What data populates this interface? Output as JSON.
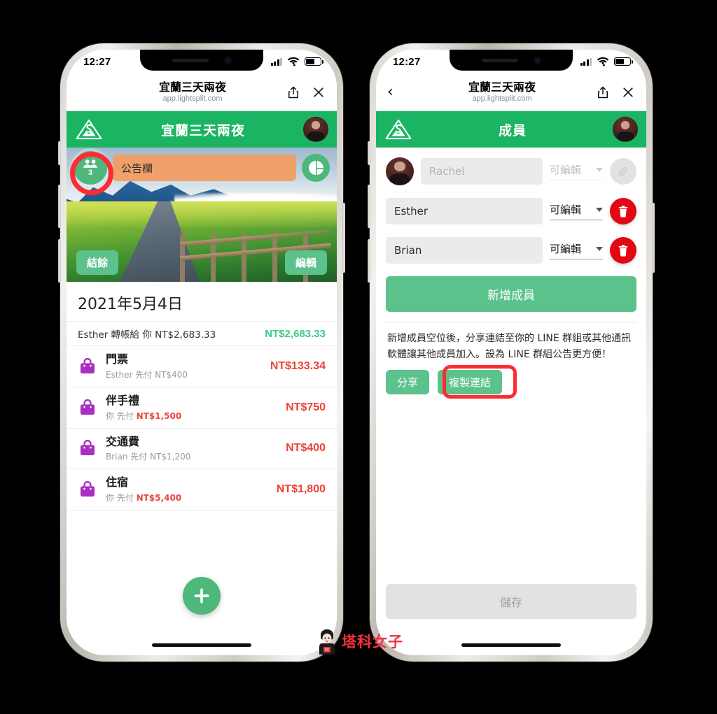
{
  "statusbar": {
    "time": "12:27"
  },
  "browser": {
    "title": "宜蘭三天兩夜",
    "url": "app.lightsplit.com",
    "share_icon": "share-icon",
    "close_icon": "close-icon",
    "back_icon": "back-chevron-icon"
  },
  "colors": {
    "brand_green": "#1bb462",
    "button_green": "#5cc28c",
    "accent_red": "#ff2b33",
    "amount_red": "#ef4136",
    "amount_green": "#3ec98a",
    "notice_orange": "#f39c61",
    "bag_purple": "#a82fc0",
    "delete_red": "#e30613"
  },
  "left_phone": {
    "appbar": {
      "title": "宜蘭三天兩夜",
      "logo_icon": "lightsplit-logo-icon",
      "avatar": "user-avatar"
    },
    "hero": {
      "member_count": "3",
      "members_icon": "people-icon",
      "notice_text": "公告欄",
      "pie_icon": "pie-chart-icon",
      "balance_button": "結餘",
      "edit_button": "編輯"
    },
    "list": {
      "date": "2021年5月4日",
      "transfer": {
        "text": "Esther 轉帳給 你 NT$2,683.33",
        "amount": "NT$2,683.33"
      },
      "items": [
        {
          "icon": "shopping-bag-icon",
          "title": "門票",
          "payer": "Esther 先付 ",
          "paid": "NT$400",
          "paid_red": false,
          "amount": "NT$133.34"
        },
        {
          "icon": "shopping-bag-icon",
          "title": "伴手禮",
          "payer": "你 先付 ",
          "paid": "NT$1,500",
          "paid_red": true,
          "amount": "NT$750"
        },
        {
          "icon": "shopping-bag-icon",
          "title": "交通費",
          "payer": "Brian 先付 ",
          "paid": "NT$1,200",
          "paid_red": false,
          "amount": "NT$400"
        },
        {
          "icon": "shopping-bag-icon",
          "title": "住宿",
          "payer": "你 先付 ",
          "paid": "NT$5,400",
          "paid_red": true,
          "amount": "NT$1,800"
        }
      ]
    },
    "fab": {
      "icon": "plus-icon"
    }
  },
  "right_phone": {
    "appbar": {
      "title": "成員",
      "logo_icon": "lightsplit-logo-icon",
      "avatar": "user-avatar"
    },
    "members": [
      {
        "name": "",
        "placeholder": "Rachel",
        "has_avatar": true,
        "permission": "可編輯",
        "action": "unlink",
        "action_icon": "broken-link-icon",
        "disabled": true
      },
      {
        "name": "Esther",
        "placeholder": "",
        "has_avatar": false,
        "permission": "可編輯",
        "action": "delete",
        "action_icon": "trash-icon",
        "disabled": false
      },
      {
        "name": "Brian",
        "placeholder": "",
        "has_avatar": false,
        "permission": "可編輯",
        "action": "delete",
        "action_icon": "trash-icon",
        "disabled": false
      }
    ],
    "add_member_button": "新增成員",
    "share_text": "新增成員空位後，分享連結至你的 LINE 群組或其他通訊軟體讓其他成員加入。設為 LINE 群組公告更方便！",
    "share_button": "分享",
    "copy_link_button": "複製連結",
    "save_button": "儲存"
  },
  "watermark": {
    "text": "塔科女子"
  }
}
